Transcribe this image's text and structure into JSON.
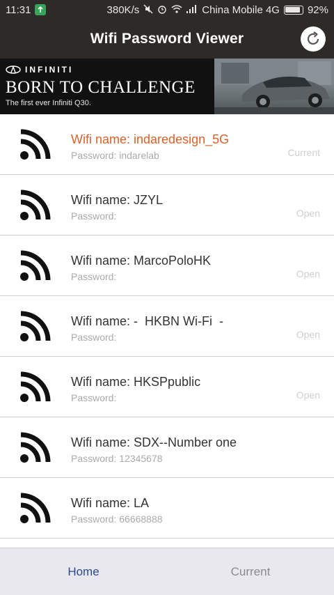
{
  "status_bar": {
    "time": "11:31",
    "speed": "380K/s",
    "carrier": "China Mobile 4G",
    "battery": "92%",
    "battery_level": 0.92
  },
  "app": {
    "title": "Wifi Password Viewer",
    "refresh_icon": "refresh-icon"
  },
  "ad": {
    "brand": "INFINITI",
    "headline": "BORN TO CHALLENGE",
    "subline": "The first ever Infiniti Q30."
  },
  "networks": [
    {
      "name": "Wifi name: indaredesign_5G",
      "password": "Password: indarelab",
      "status": "Current",
      "is_current": true
    },
    {
      "name": "Wifi name: JZYL",
      "password": "Password:",
      "status": "Open",
      "is_current": false
    },
    {
      "name": "Wifi name: MarcoPoloHK",
      "password": "Password:",
      "status": "Open",
      "is_current": false
    },
    {
      "name": "Wifi name: -  HKBN Wi-Fi  -",
      "password": "Password:",
      "status": "Open",
      "is_current": false
    },
    {
      "name": "Wifi name: HKSPpublic",
      "password": "Password:",
      "status": "Open",
      "is_current": false
    },
    {
      "name": "Wifi name: SDX--Number one",
      "password": "Password: 12345678",
      "status": "",
      "is_current": false
    },
    {
      "name": "Wifi name: LA",
      "password": "Password: 66668888",
      "status": "",
      "is_current": false
    }
  ],
  "bottom_nav": {
    "tabs": [
      {
        "label": "Home",
        "active": true
      },
      {
        "label": "Current",
        "active": false
      }
    ]
  },
  "colors": {
    "header_bg": "#2e2a28",
    "current_accent": "#d9612a",
    "nav_active": "#2b4a8b"
  }
}
